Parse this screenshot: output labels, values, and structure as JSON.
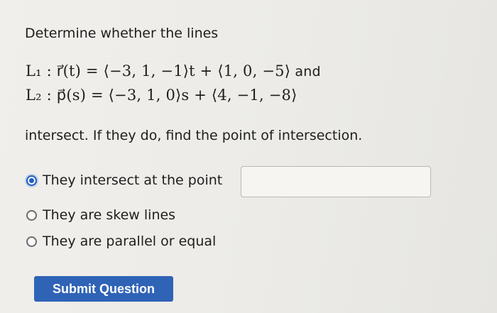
{
  "question": {
    "prompt": "Determine whether the lines",
    "line1_math": "L₁ : r⃗(t) = ⟨−3, 1, −1⟩t + ⟨1, 0, −5⟩",
    "line1_connector": "and",
    "line2_math": "L₂ : p⃗(s) = ⟨−3, 1, 0⟩s + ⟨4, −1, −8⟩",
    "instruction": "intersect. If they do, find the point of intersection."
  },
  "options": [
    {
      "label": "They intersect at the point",
      "selected": true
    },
    {
      "label": "They are skew lines",
      "selected": false
    },
    {
      "label": "They are parallel or equal",
      "selected": false
    }
  ],
  "answer": {
    "value": ""
  },
  "submit": {
    "label": "Submit Question",
    "color": "#2f63b6"
  },
  "colors": {
    "radio_selected": "#1f5fc4",
    "page_background": "#eceae6"
  }
}
